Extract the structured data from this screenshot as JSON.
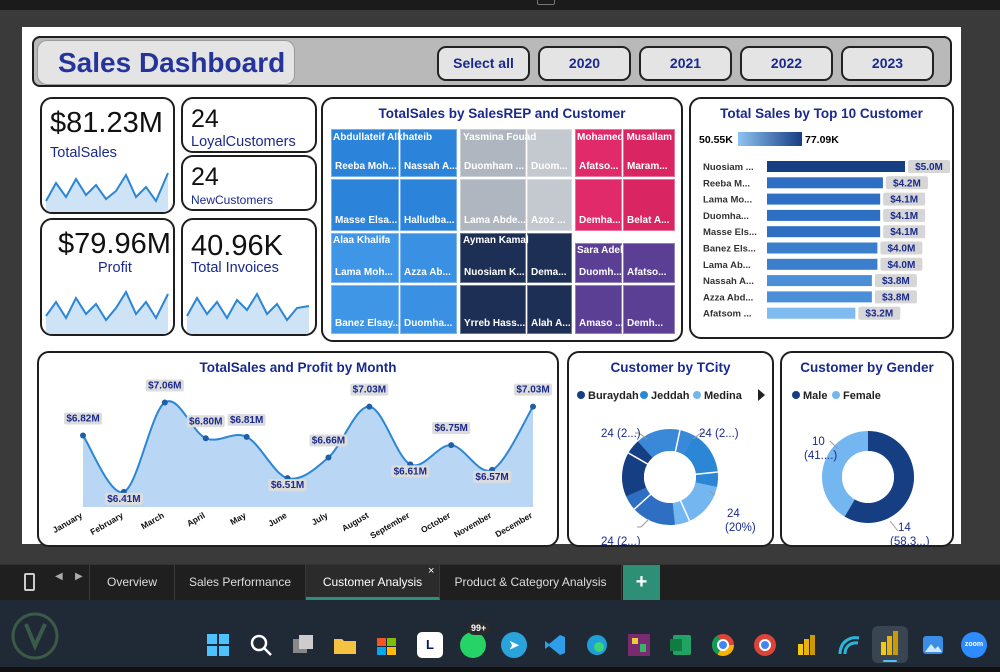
{
  "header": {
    "title": "Sales Dashboard",
    "buttons": [
      "Select all",
      "2020",
      "2021",
      "2022",
      "2023"
    ]
  },
  "kpis": {
    "total_sales": {
      "value": "$81.23M",
      "label": "TotalSales"
    },
    "loyal": {
      "value": "24",
      "label": "LoyalCustomers"
    },
    "new": {
      "value": "24",
      "label": "NewCustomers"
    },
    "profit": {
      "value": "$79.96M",
      "label": "Profit"
    },
    "invoices": {
      "value": "40.96K",
      "label": "Total Invoices"
    }
  },
  "treemap": {
    "title": "TotalSales by SalesREP and Customer",
    "reps": {
      "r1": "Abdullateif Alkhateib",
      "r2": "Yasmina Fouad",
      "r3": "Mohamed Musallam",
      "r4": "Alaa Khalifa",
      "r5": "Ayman Kamal",
      "r6": "Sara Adel"
    },
    "cells": [
      "Reeba Moh...",
      "Nassah A...",
      "Duomham ...",
      "Duom...",
      "Afatso...",
      "Maram...",
      "Masse Elsa...",
      "Halludba...",
      "Lama Abde...",
      "Azoz ...",
      "Demha...",
      "Belat A...",
      "Lama Moh...",
      "Azza Ab...",
      "Nuosiam K...",
      "Dema...",
      "Duomh...",
      "Afatso...",
      "Banez Elsay...",
      "Duomha...",
      "Yrreb Hass...",
      "Alah A...",
      "Amaso ...",
      "Demh..."
    ]
  },
  "top10": {
    "title": "Total Sales by Top 10 Customer",
    "scale_min": "50.55K",
    "scale_max": "77.09K",
    "customers": [
      "Nuosiam ...",
      "Reeba M...",
      "Lama Mo...",
      "Duomha...",
      "Masse Els...",
      "Banez Els...",
      "Lama Ab...",
      "Nassah A...",
      "Azza Abd...",
      "Afatsom ..."
    ],
    "labels": [
      "$5.0M",
      "$4.2M",
      "$4.1M",
      "$4.1M",
      "$4.1M",
      "$4.0M",
      "$4.0M",
      "$3.8M",
      "$3.8M",
      "$3.2M"
    ],
    "values": [
      5.0,
      4.2,
      4.1,
      4.1,
      4.1,
      4.0,
      4.0,
      3.8,
      3.8,
      3.2
    ]
  },
  "monthly": {
    "title": "TotalSales and Profit by Month",
    "months": [
      "January",
      "February",
      "March",
      "April",
      "May",
      "June",
      "July",
      "August",
      "September",
      "October",
      "November",
      "December"
    ],
    "values": [
      6.82,
      6.41,
      7.06,
      6.8,
      6.81,
      6.51,
      6.66,
      7.03,
      6.61,
      6.75,
      6.57,
      7.03
    ],
    "labels": [
      "$6.82M",
      "$6.41M",
      "$7.06M",
      "$6.80M",
      "$6.81M",
      "$6.51M",
      "$6.66M",
      "$7.03M",
      "$6.61M",
      "$6.75M",
      "$6.57M",
      "$7.03M"
    ]
  },
  "city": {
    "title": "Customer by TCity",
    "legend": [
      "Buraydah",
      "Jeddah",
      "Medina"
    ],
    "labels": {
      "tl": "24 (2...)",
      "tr": "24 (2...)",
      "r1": "24",
      "r2": "(20%)",
      "bl": "24 (2...)"
    }
  },
  "gender": {
    "title": "Customer by Gender",
    "legend": [
      "Male",
      "Female"
    ],
    "labels": {
      "f1": "10",
      "f2": "(41....)",
      "m1": "14",
      "m2": "(58.3...)"
    }
  },
  "tabs": [
    "Overview",
    "Sales Performance",
    "Customer Analysis",
    "Product & Category Analysis"
  ],
  "taskbar": {
    "whatsapp_badge": "99+",
    "l_label": "L",
    "zoom_label": "zoom"
  },
  "colors": {
    "navy": "#1a2a8c",
    "area": "#b9d7f5",
    "line": "#2b86d6",
    "active_tab": "#2c8f76"
  },
  "chart_data": [
    {
      "type": "line",
      "title": "TotalSales and Profit by Month",
      "categories": [
        "January",
        "February",
        "March",
        "April",
        "May",
        "June",
        "July",
        "August",
        "September",
        "October",
        "November",
        "December"
      ],
      "series": [
        {
          "values": [
            6.82,
            6.41,
            7.06,
            6.8,
            6.81,
            6.51,
            6.66,
            7.03,
            6.61,
            6.75,
            6.57,
            7.03
          ]
        }
      ],
      "unit": "$M"
    },
    {
      "type": "bar",
      "title": "Total Sales by Top 10 Customer",
      "categories": [
        "Nuosiam ...",
        "Reeba M...",
        "Lama Mo...",
        "Duomha...",
        "Masse Els...",
        "Banez Els...",
        "Lama Ab...",
        "Nassah A...",
        "Azza Abd...",
        "Afatsom ..."
      ],
      "values": [
        5.0,
        4.2,
        4.1,
        4.1,
        4.1,
        4.0,
        4.0,
        3.8,
        3.8,
        3.2
      ],
      "unit": "$M"
    },
    {
      "type": "pie",
      "title": "Customer by TCity",
      "categories": [
        "Buraydah",
        "Jeddah",
        "Medina"
      ]
    },
    {
      "type": "pie",
      "title": "Customer by Gender",
      "categories": [
        "Male",
        "Female"
      ],
      "values": [
        14,
        10
      ]
    }
  ]
}
